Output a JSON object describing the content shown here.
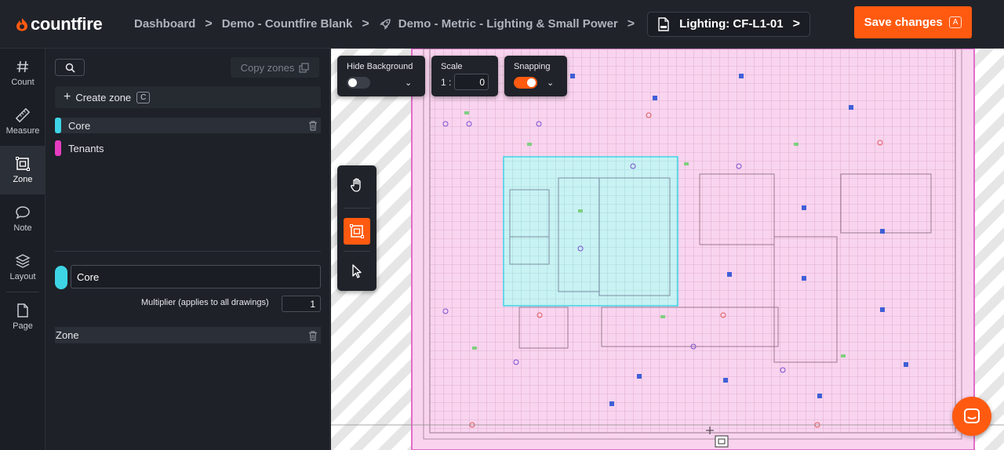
{
  "brand": {
    "name": "countfire",
    "accent": "#ff5a10"
  },
  "breadcrumb": {
    "items": [
      "Dashboard",
      "Demo - Countfire Blank",
      "Demo - Metric - Lighting & Small Power"
    ],
    "current_doc": "Lighting: CF-L1-01"
  },
  "header": {
    "save_label": "Save changes",
    "save_shortcut": "A"
  },
  "rail": {
    "items": [
      {
        "label": "Count",
        "icon": "hash-icon"
      },
      {
        "label": "Measure",
        "icon": "ruler-icon"
      },
      {
        "label": "Zone",
        "icon": "zone-icon",
        "active": true
      },
      {
        "label": "Note",
        "icon": "speech-bubble-icon"
      },
      {
        "label": "Layout",
        "icon": "layers-icon"
      },
      {
        "label": "Page",
        "icon": "page-icon"
      }
    ]
  },
  "panel": {
    "copy_zones_label": "Copy zones",
    "create_zone_label": "Create zone",
    "create_zone_shortcut": "C",
    "zones": [
      {
        "name": "Core",
        "color": "#3dd4e6",
        "selected": true
      },
      {
        "name": "Tenants",
        "color": "#e63cc0",
        "selected": false
      }
    ],
    "editor": {
      "name_value": "Core",
      "swatch_color": "#3dd4e6",
      "multiplier_label": "Multiplier (applies to all drawings)",
      "multiplier_value": "1",
      "zone_section_label": "Zone"
    }
  },
  "controls": {
    "hide_background": {
      "label": "Hide Background",
      "on": false
    },
    "scale": {
      "label": "Scale",
      "prefix": "1 :",
      "value": "0"
    },
    "snapping": {
      "label": "Snapping",
      "on": true
    }
  },
  "tools": [
    {
      "name": "pan",
      "icon": "hand-icon"
    },
    {
      "name": "zone-draw",
      "icon": "zone-draw-icon",
      "active": true
    },
    {
      "name": "select",
      "icon": "cursor-icon"
    }
  ]
}
